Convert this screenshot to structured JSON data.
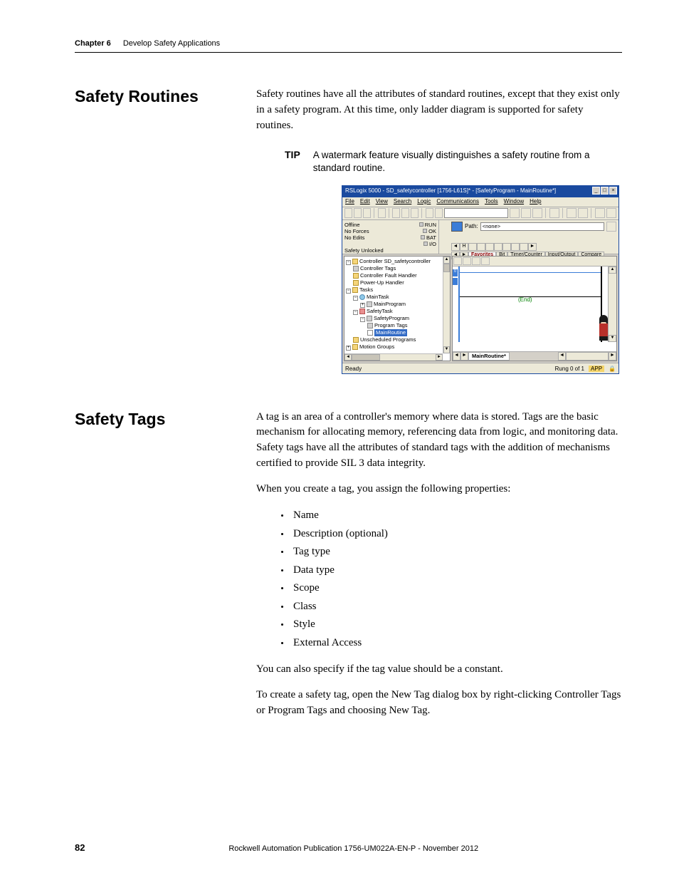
{
  "header": {
    "chapter": "Chapter 6",
    "title": "Develop Safety Applications"
  },
  "section1": {
    "heading": "Safety Routines",
    "para1": "Safety routines have all the attributes of standard routines, except that they exist only in a safety program. At this time, only ladder diagram is supported for safety routines.",
    "tip_label": "TIP",
    "tip_text": "A watermark feature visually distinguishes a safety routine from a standard routine."
  },
  "screenshot": {
    "title": "RSLogix 5000 - SD_safetycontroller [1756-L61S]* - [SafetyProgram - MainRoutine*]",
    "menu": [
      "File",
      "Edit",
      "View",
      "Search",
      "Logic",
      "Communications",
      "Tools",
      "Window",
      "Help"
    ],
    "status": {
      "offline": "Offline",
      "run": "RUN",
      "noforces": "No Forces",
      "ok": "OK",
      "noedits": "No Edits",
      "bat": "BAT",
      "io": "I/O",
      "safety_unlocked": "Safety Unlocked"
    },
    "path_label": "Path:",
    "path_value": "<none>",
    "tabs": [
      "Favorites",
      "Bit",
      "Timer/Counter",
      "Input/Output",
      "Compare"
    ],
    "tree": {
      "root": "Controller SD_safetycontroller",
      "n1": "Controller Tags",
      "n2": "Controller Fault Handler",
      "n3": "Power-Up Handler",
      "n4": "Tasks",
      "n5": "MainTask",
      "n6": "MainProgram",
      "n7": "SafetyTask",
      "n8": "SafetyProgram",
      "n9": "Program Tags",
      "n10": "MainRoutine",
      "n11": "Unscheduled Programs",
      "n12": "Motion Groups"
    },
    "rung0": "0",
    "end": "(End)",
    "ladder_tab": "MainRoutine*",
    "statusbar": {
      "ready": "Ready",
      "rung": "Rung 0 of 1",
      "app": "APP"
    }
  },
  "section2": {
    "heading": "Safety Tags",
    "para1": "A tag is an area of a controller's memory where data is stored. Tags are the basic mechanism for allocating memory, referencing data from logic, and monitoring data. Safety tags have all the attributes of standard tags with the addition of mechanisms certified to provide SIL 3 data integrity.",
    "para2": "When you create a tag, you assign the following properties:",
    "bullets": [
      "Name",
      "Description (optional)",
      "Tag type",
      "Data type",
      "Scope",
      "Class",
      "Style",
      "External Access"
    ],
    "para3": "You can also specify if the tag value should be a constant.",
    "para4": "To create a safety tag, open the New Tag dialog box by right-clicking Controller Tags or Program Tags and choosing New Tag."
  },
  "footer": {
    "page": "82",
    "pub": "Rockwell Automation Publication 1756-UM022A-EN-P - November 2012"
  }
}
